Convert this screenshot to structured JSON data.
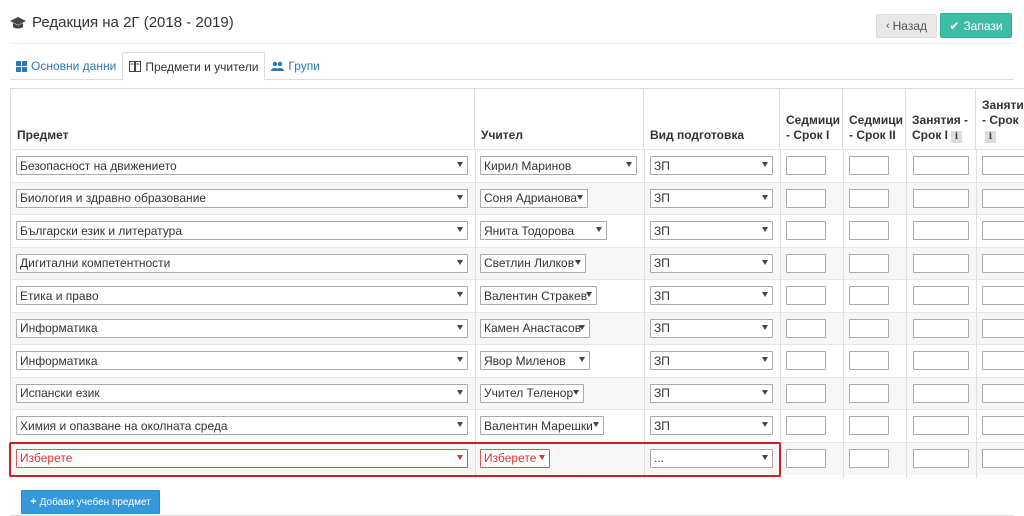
{
  "header": {
    "title": "Редакция на 2Г (2018 - 2019)",
    "icon": "graduation-cap-icon"
  },
  "actions": {
    "back_label": "Назад",
    "save_label": "Запази"
  },
  "tabs": [
    {
      "label": "Основни данни",
      "icon": "grid-icon"
    },
    {
      "label": "Предмети и учители",
      "icon": "book-icon"
    },
    {
      "label": "Групи",
      "icon": "users-icon"
    }
  ],
  "columns": {
    "subject": "Предмет",
    "teacher": "Учител",
    "prep": "Вид подготовка",
    "weeks1": "Седмици - Срок I",
    "weeks2": "Седмици - Срок II",
    "lessons1": "Занятия - Срок I",
    "lessons2": "Занятия - Срок"
  },
  "rows": [
    {
      "subject": "Безопасност на движението",
      "teacher": "Кирил Маринов",
      "prep": "ЗП"
    },
    {
      "subject": "Биология и здравно образование",
      "teacher": "Соня Адрианова",
      "prep": "ЗП"
    },
    {
      "subject": "Български език и литература",
      "teacher": "Янита Тодорова",
      "prep": "ЗП"
    },
    {
      "subject": "Дигитални компетентности",
      "teacher": "Светлин Лилков",
      "prep": "ЗП"
    },
    {
      "subject": "Етика и право",
      "teacher": "Валентин Стракев",
      "prep": "ЗП"
    },
    {
      "subject": "Информатика",
      "teacher": "Камен Анастасов",
      "prep": "ЗП"
    },
    {
      "subject": "Информатика",
      "teacher": "Явор Миленов",
      "prep": "ЗП"
    },
    {
      "subject": "Испански език",
      "teacher": "Учител Теленор",
      "prep": "ЗП"
    },
    {
      "subject": "Химия и опазване на околната среда",
      "teacher": "Валентин Марешки",
      "prep": "ЗП"
    },
    {
      "subject": "Изберете",
      "teacher": "Изберете",
      "prep": "..."
    }
  ],
  "add_button_label": "Добави учебен предмет",
  "colors": {
    "save": "#3dbda5",
    "add": "#3498db",
    "highlight": "#cc2222",
    "link": "#2a78b4"
  }
}
